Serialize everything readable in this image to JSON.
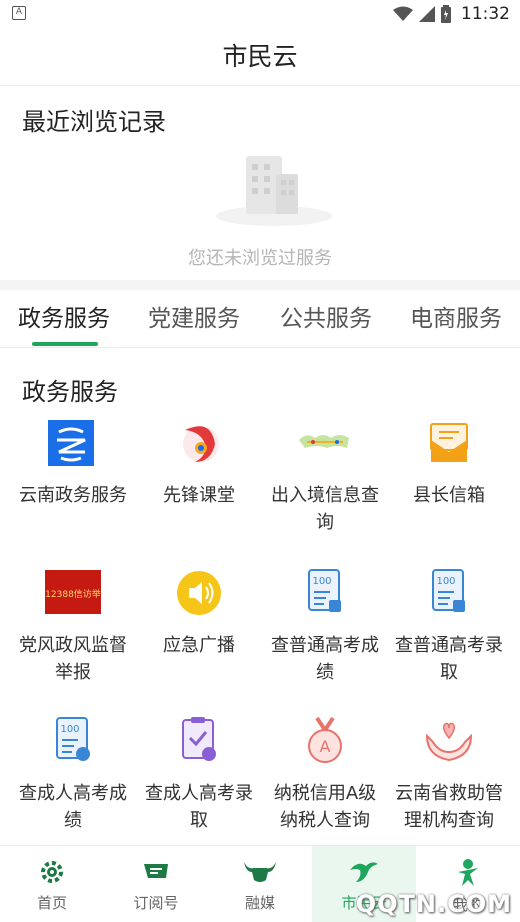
{
  "status_bar": {
    "time": "11:32",
    "app_badge": "A"
  },
  "header": {
    "title": "市民云"
  },
  "recent": {
    "title": "最近浏览记录",
    "empty_text": "您还未浏览过服务"
  },
  "tabs": [
    {
      "label": "政务服务",
      "active": true
    },
    {
      "label": "党建服务",
      "active": false
    },
    {
      "label": "公共服务",
      "active": false
    },
    {
      "label": "电商服务",
      "active": false
    }
  ],
  "section": {
    "title": "政务服务",
    "items": [
      {
        "label": "云南政务服务",
        "icon": "yunnan-gov-service-icon"
      },
      {
        "label": "先锋课堂",
        "icon": "pioneer-class-icon"
      },
      {
        "label": "出入境信息查询",
        "icon": "entry-exit-info-icon"
      },
      {
        "label": "县长信箱",
        "icon": "county-mailbox-icon"
      },
      {
        "label": "党风政风监督举报",
        "icon": "supervision-report-icon",
        "badge_text": "12388信访举"
      },
      {
        "label": "应急广播",
        "icon": "emergency-broadcast-icon"
      },
      {
        "label": "查普通高考成绩",
        "icon": "gaokao-score-icon",
        "badge_text": "100"
      },
      {
        "label": "查普通高考录取",
        "icon": "gaokao-admission-icon",
        "badge_text": "100"
      },
      {
        "label": "查成人高考成绩",
        "icon": "adult-exam-score-icon",
        "badge_text": "100"
      },
      {
        "label": "查成人高考录取",
        "icon": "adult-exam-admission-icon"
      },
      {
        "label": "纳税信用A级纳税人查询",
        "icon": "tax-credit-medal-icon"
      },
      {
        "label": "云南省救助管理机构查询",
        "icon": "relief-agency-icon"
      }
    ]
  },
  "bottom_nav": [
    {
      "label": "首页",
      "icon": "home-gear-icon",
      "active": false
    },
    {
      "label": "订阅号",
      "icon": "subscription-icon",
      "active": false
    },
    {
      "label": "融媒",
      "icon": "bull-media-icon",
      "active": false
    },
    {
      "label": "市民云",
      "icon": "citizen-cloud-icon",
      "active": true
    },
    {
      "label": "我的",
      "icon": "profile-icon",
      "active": false
    }
  ],
  "watermark": "QQTN.COM",
  "colors": {
    "accent": "#1ea55e",
    "muted_text": "#b5b5b5",
    "divider": "#ececec"
  }
}
